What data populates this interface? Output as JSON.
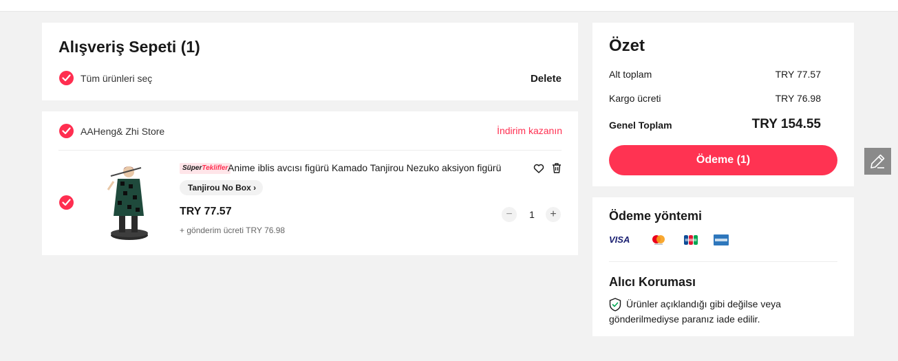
{
  "cart": {
    "title": "Alışveriş Sepeti (1)",
    "select_all_label": "Tüm ürünleri seç",
    "delete_label": "Delete"
  },
  "store": {
    "name": "AAHeng& Zhi Store",
    "discount_link": "İndirim kazanın"
  },
  "product": {
    "badge_left": "Süper",
    "badge_right": "Teklifler",
    "title": "Anime iblis avcısı figürü Kamado Tanjirou Nezuko aksiyon figürü",
    "variant": "Tanjirou No Box",
    "price": "TRY 77.57",
    "shipping_note": "+ gönderim ücreti TRY 76.98",
    "quantity": "1",
    "minus_symbol": "−",
    "plus_symbol": "+"
  },
  "summary": {
    "title": "Özet",
    "subtotal_label": "Alt toplam",
    "subtotal_value": "TRY 77.57",
    "shipping_label": "Kargo ücreti",
    "shipping_value": "TRY 76.98",
    "total_label": "Genel Toplam",
    "total_value": "TRY 154.55",
    "checkout_label": "Ödeme (1)"
  },
  "payment": {
    "title": "Ödeme yöntemi",
    "methods": [
      "visa-logo",
      "mastercard-logo",
      "jcb-logo",
      "amex-logo"
    ],
    "visa_text": "VISA"
  },
  "protection": {
    "title": "Alıcı Koruması",
    "text": "Ürünler açıklandığı gibi değilse veya gönderilmediyse paranız iade edilir."
  },
  "colors": {
    "accent": "#ff2e50",
    "checkout": "#ff3352",
    "background": "#f2f2f2"
  }
}
